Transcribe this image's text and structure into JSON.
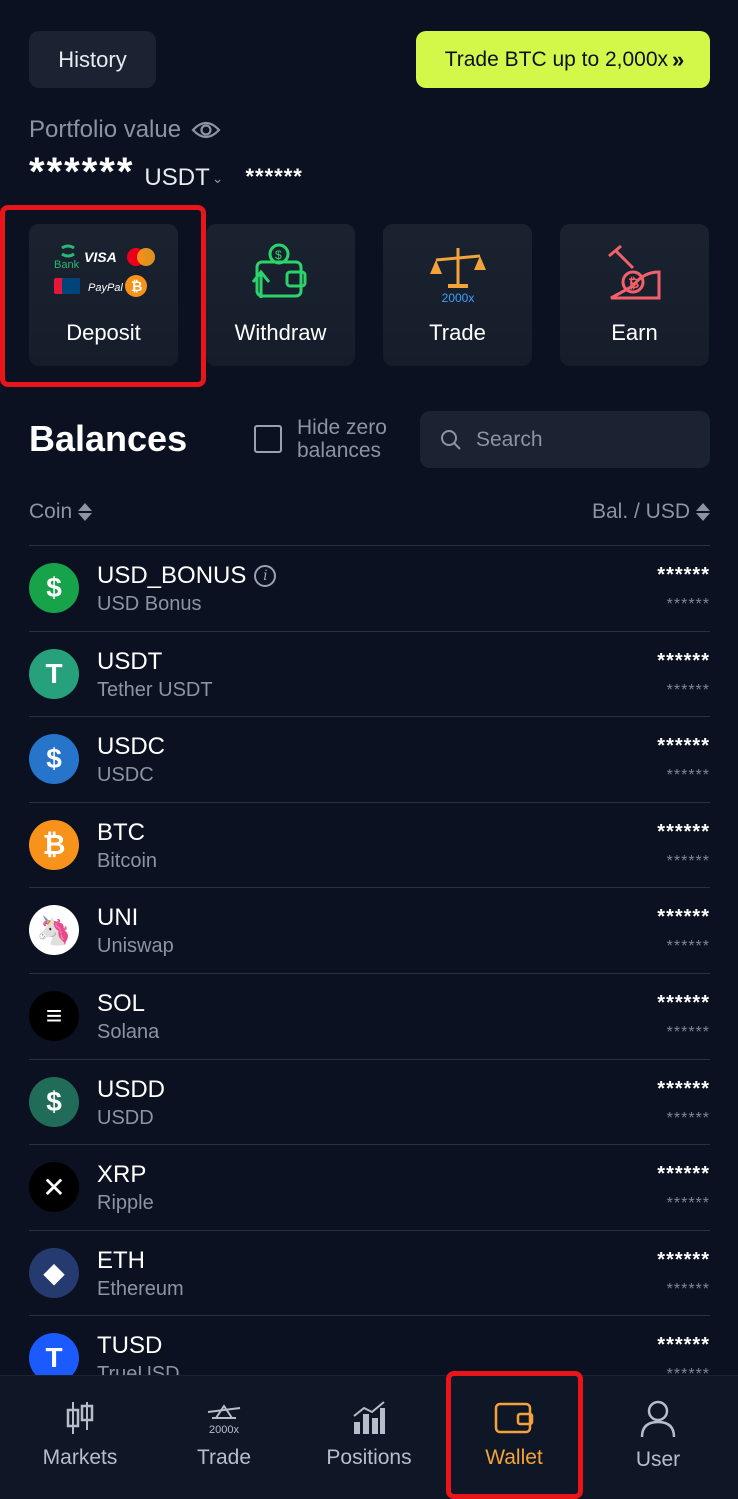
{
  "header": {
    "history_label": "History",
    "promo_label": "Trade BTC up to 2,000x",
    "promo_chevron": "»"
  },
  "portfolio": {
    "label": "Portfolio value",
    "value": "******",
    "currency": "USDT",
    "secondary_value": "******"
  },
  "actions": [
    {
      "label": "Deposit",
      "icon": "payment-methods-icon"
    },
    {
      "label": "Withdraw",
      "icon": "wallet-money-icon"
    },
    {
      "label": "Trade",
      "icon": "scale-2000x-icon",
      "icon_text": "2000x"
    },
    {
      "label": "Earn",
      "icon": "mining-bitcoin-icon"
    }
  ],
  "deposit_icon_text": {
    "bank": "Bank",
    "visa": "VISA",
    "mastercard": "MasterCard",
    "unionpay": "UnionPay",
    "paypal": "PayPal"
  },
  "balances": {
    "title": "Balances",
    "hide_zero_label": "Hide zero balances",
    "hide_zero_checked": false,
    "search_placeholder": "Search",
    "col_coin": "Coin",
    "col_balance": "Bal. / USD"
  },
  "coins": [
    {
      "symbol": "USD_BONUS",
      "name": "USD Bonus",
      "balance": "******",
      "usd": "******",
      "color": "#17a34a",
      "glyph": "$",
      "info": true
    },
    {
      "symbol": "USDT",
      "name": "Tether USDT",
      "balance": "******",
      "usd": "******",
      "color": "#26a17b",
      "glyph": "T"
    },
    {
      "symbol": "USDC",
      "name": "USDC",
      "balance": "******",
      "usd": "******",
      "color": "#2775ca",
      "glyph": "$"
    },
    {
      "symbol": "BTC",
      "name": "Bitcoin",
      "balance": "******",
      "usd": "******",
      "color": "#f7931a",
      "glyph": "₿"
    },
    {
      "symbol": "UNI",
      "name": "Uniswap",
      "balance": "******",
      "usd": "******",
      "color": "#ffffff",
      "glyph": "🦄"
    },
    {
      "symbol": "SOL",
      "name": "Solana",
      "balance": "******",
      "usd": "******",
      "color": "#000000",
      "glyph": "≡"
    },
    {
      "symbol": "USDD",
      "name": "USDD",
      "balance": "******",
      "usd": "******",
      "color": "#216c58",
      "glyph": "$"
    },
    {
      "symbol": "XRP",
      "name": "Ripple",
      "balance": "******",
      "usd": "******",
      "color": "#000000",
      "glyph": "✕"
    },
    {
      "symbol": "ETH",
      "name": "Ethereum",
      "balance": "******",
      "usd": "******",
      "color": "#253a6e",
      "glyph": "◆"
    },
    {
      "symbol": "TUSD",
      "name": "TrueUSD",
      "balance": "******",
      "usd": "******",
      "color": "#1a5aff",
      "glyph": "T"
    }
  ],
  "nav": [
    {
      "label": "Markets",
      "icon": "candlestick-icon"
    },
    {
      "label": "Trade",
      "icon": "scale-icon",
      "icon_text": "2000x"
    },
    {
      "label": "Positions",
      "icon": "bar-chart-icon"
    },
    {
      "label": "Wallet",
      "icon": "wallet-icon",
      "active": true
    },
    {
      "label": "User",
      "icon": "user-icon"
    }
  ],
  "colors": {
    "background": "#0b1120",
    "promo": "#d4f84a",
    "active_nav": "#f4a23a",
    "highlight": "#e8161a"
  }
}
